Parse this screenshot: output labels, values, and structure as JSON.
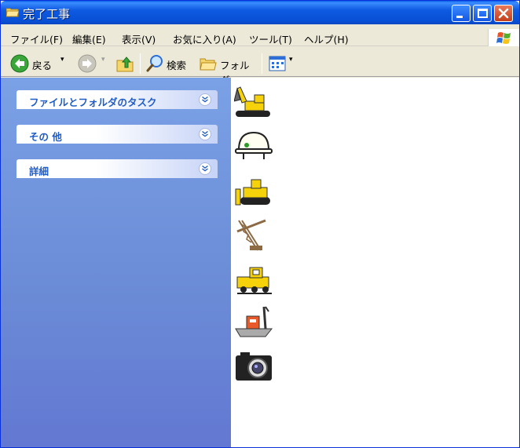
{
  "window": {
    "title": "完了工事"
  },
  "menu": [
    {
      "label": "ファイル(F)"
    },
    {
      "label": "編集(E)"
    },
    {
      "label": "表示(V)"
    },
    {
      "label": "お気に入り(A)"
    },
    {
      "label": "ツール(T)"
    },
    {
      "label": "ヘルプ(H)"
    }
  ],
  "toolbar": {
    "back_label": "戻る",
    "search_label": "検索",
    "folders_label": "フォルダ"
  },
  "taskpane": {
    "groups": [
      {
        "label": "ファイルとフォルダのタスク"
      },
      {
        "label": "その 他"
      },
      {
        "label": "詳細"
      }
    ]
  },
  "files": [
    {
      "icon": "excavator-icon",
      "name": ""
    },
    {
      "icon": "hardhat-icon",
      "name": ""
    },
    {
      "icon": "bulldozer-icon",
      "name": ""
    },
    {
      "icon": "crane-icon",
      "name": ""
    },
    {
      "icon": "train-icon",
      "name": ""
    },
    {
      "icon": "ship-icon",
      "name": ""
    },
    {
      "icon": "camera-icon",
      "name": ""
    }
  ],
  "colors": {
    "titlebar": "#0a5de8",
    "taskpane": "#6a8ad6",
    "group_text": "#215dc6"
  }
}
